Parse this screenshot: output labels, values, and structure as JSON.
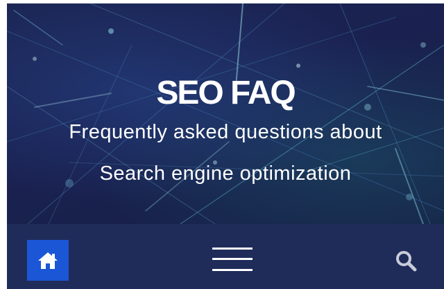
{
  "hero": {
    "title": "SEO FAQ",
    "subtitle_line1": "Frequently asked questions about",
    "subtitle_line2": "Search engine optimization"
  },
  "navbar": {
    "home_icon": "home-icon",
    "menu_icon": "hamburger-menu-icon",
    "search_icon": "search-icon"
  },
  "colors": {
    "hero_background": "#1b2553",
    "navbar_background": "#1f2c5a",
    "home_button_background": "#1a56d6",
    "text": "#ffffff"
  }
}
